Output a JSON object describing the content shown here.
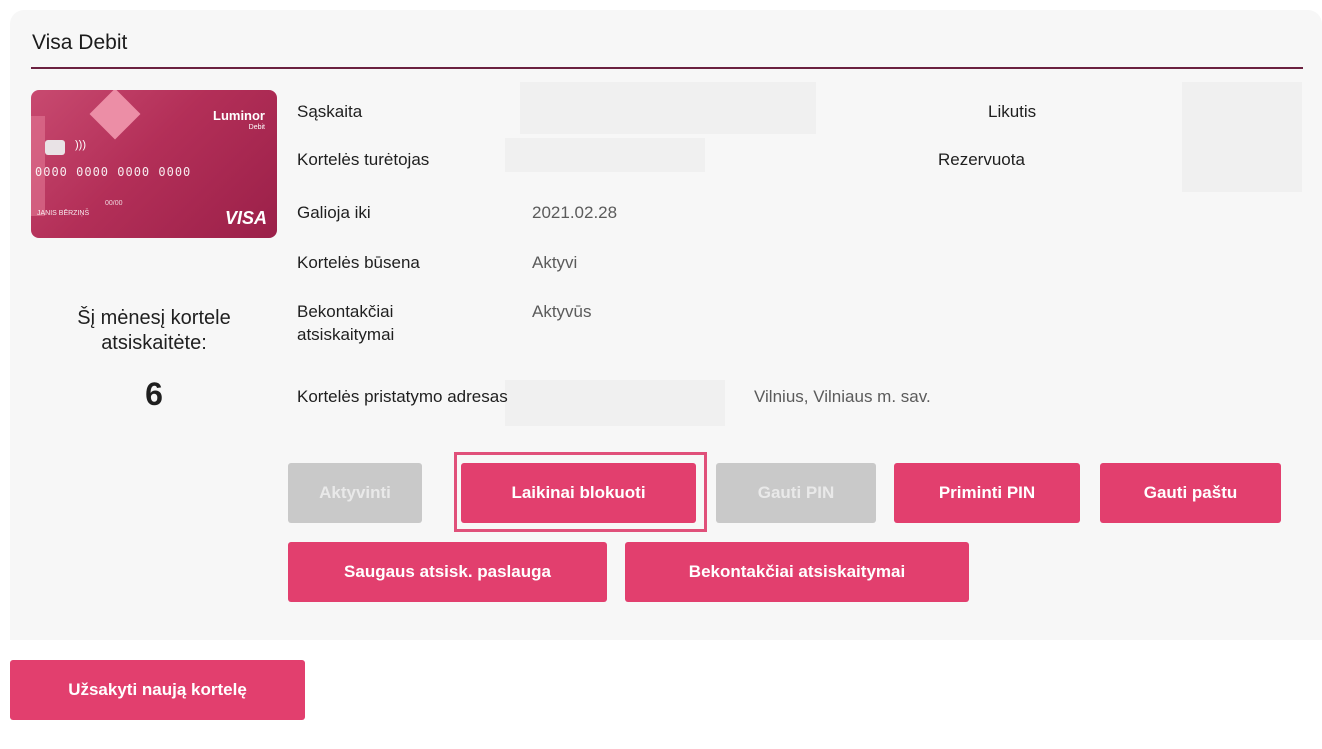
{
  "panel": {
    "title": "Visa Debit"
  },
  "card": {
    "brand": "Luminor",
    "brand_sub": "Debit",
    "number": "0000 0000 0000 0000",
    "holder": "JANIS BĒRZIŅŠ",
    "expiry": "00/00",
    "network": "VISA",
    "colors": {
      "primary": "#b32f58",
      "accent": "#ec8ea6"
    }
  },
  "monthly": {
    "label": "Šį mėnesį kortele atsiskaitėte:",
    "count": "6"
  },
  "details": {
    "account_label": "Sąskaita",
    "balance_label": "Likutis",
    "holder_label": "Kortelės turėtojas",
    "reserved_label": "Rezervuota",
    "valid_until_label": "Galioja iki",
    "valid_until_value": "2021.02.28",
    "status_label": "Kortelės būsena",
    "status_value": "Aktyvi",
    "contactless_label": "Bekontakčiai atsiskaitymai",
    "contactless_value": "Aktyvūs",
    "delivery_label": "Kortelės pristatymo adresas",
    "delivery_value": "Vilnius, Vilniaus m. sav."
  },
  "actions": {
    "activate": "Aktyvinti",
    "temp_block": "Laikinai blokuoti",
    "get_pin": "Gauti PIN",
    "remind_pin": "Priminti PIN",
    "get_by_mail": "Gauti paštu",
    "secure_payment": "Saugaus atsisk. paslauga",
    "contactless": "Bekontakčiai atsiskaitymai"
  },
  "footer": {
    "order_new_card": "Užsakyti naują kortelę"
  },
  "colors": {
    "accent": "#e23f6e",
    "disabled": "#c9c9c9",
    "rule": "#6b2140",
    "highlight": "#e0507a"
  }
}
